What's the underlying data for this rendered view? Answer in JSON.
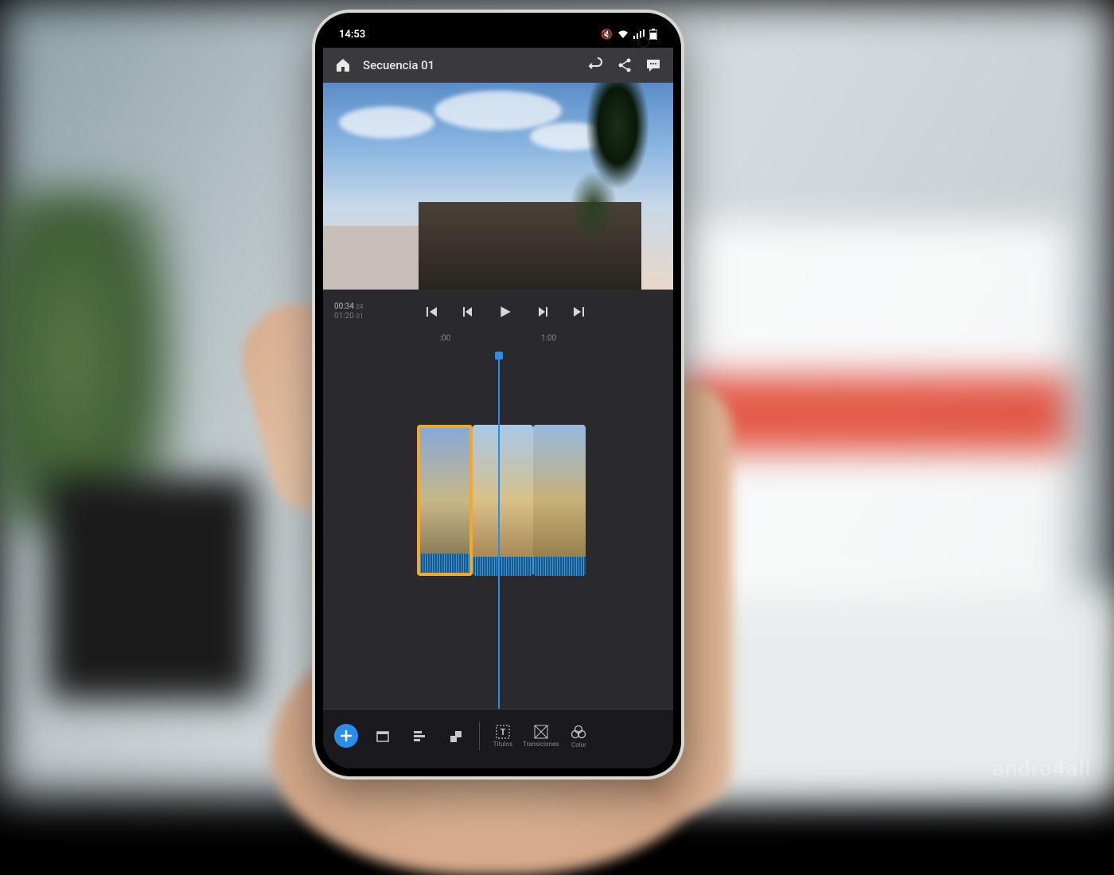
{
  "statusbar": {
    "time": "14:53",
    "icons": [
      "mute",
      "wifi",
      "signal",
      "battery"
    ]
  },
  "topbar": {
    "title": "Secuencia 01"
  },
  "playback": {
    "current": "00:34",
    "current_frame": "24",
    "total": "01:20",
    "total_frame": "01"
  },
  "ruler": {
    "marks": [
      ":00",
      "1:00"
    ]
  },
  "bottom": {
    "titulos": "Títulos",
    "transiciones": "Transiciones",
    "color": "Color"
  },
  "watermark": "andro4all"
}
